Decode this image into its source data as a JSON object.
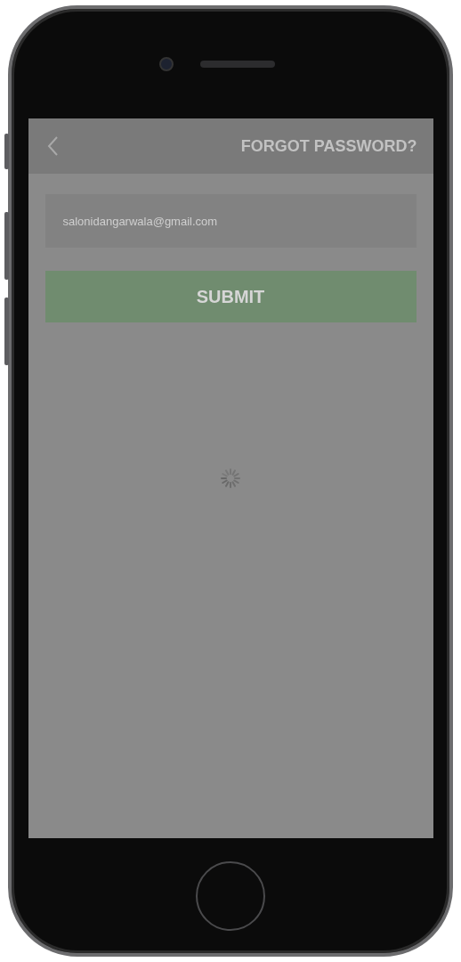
{
  "header": {
    "title": "FORGOT PASSWORD?"
  },
  "form": {
    "email_value": "salonidangarwala@gmail.com",
    "submit_label": "SUBMIT"
  },
  "loading": true
}
